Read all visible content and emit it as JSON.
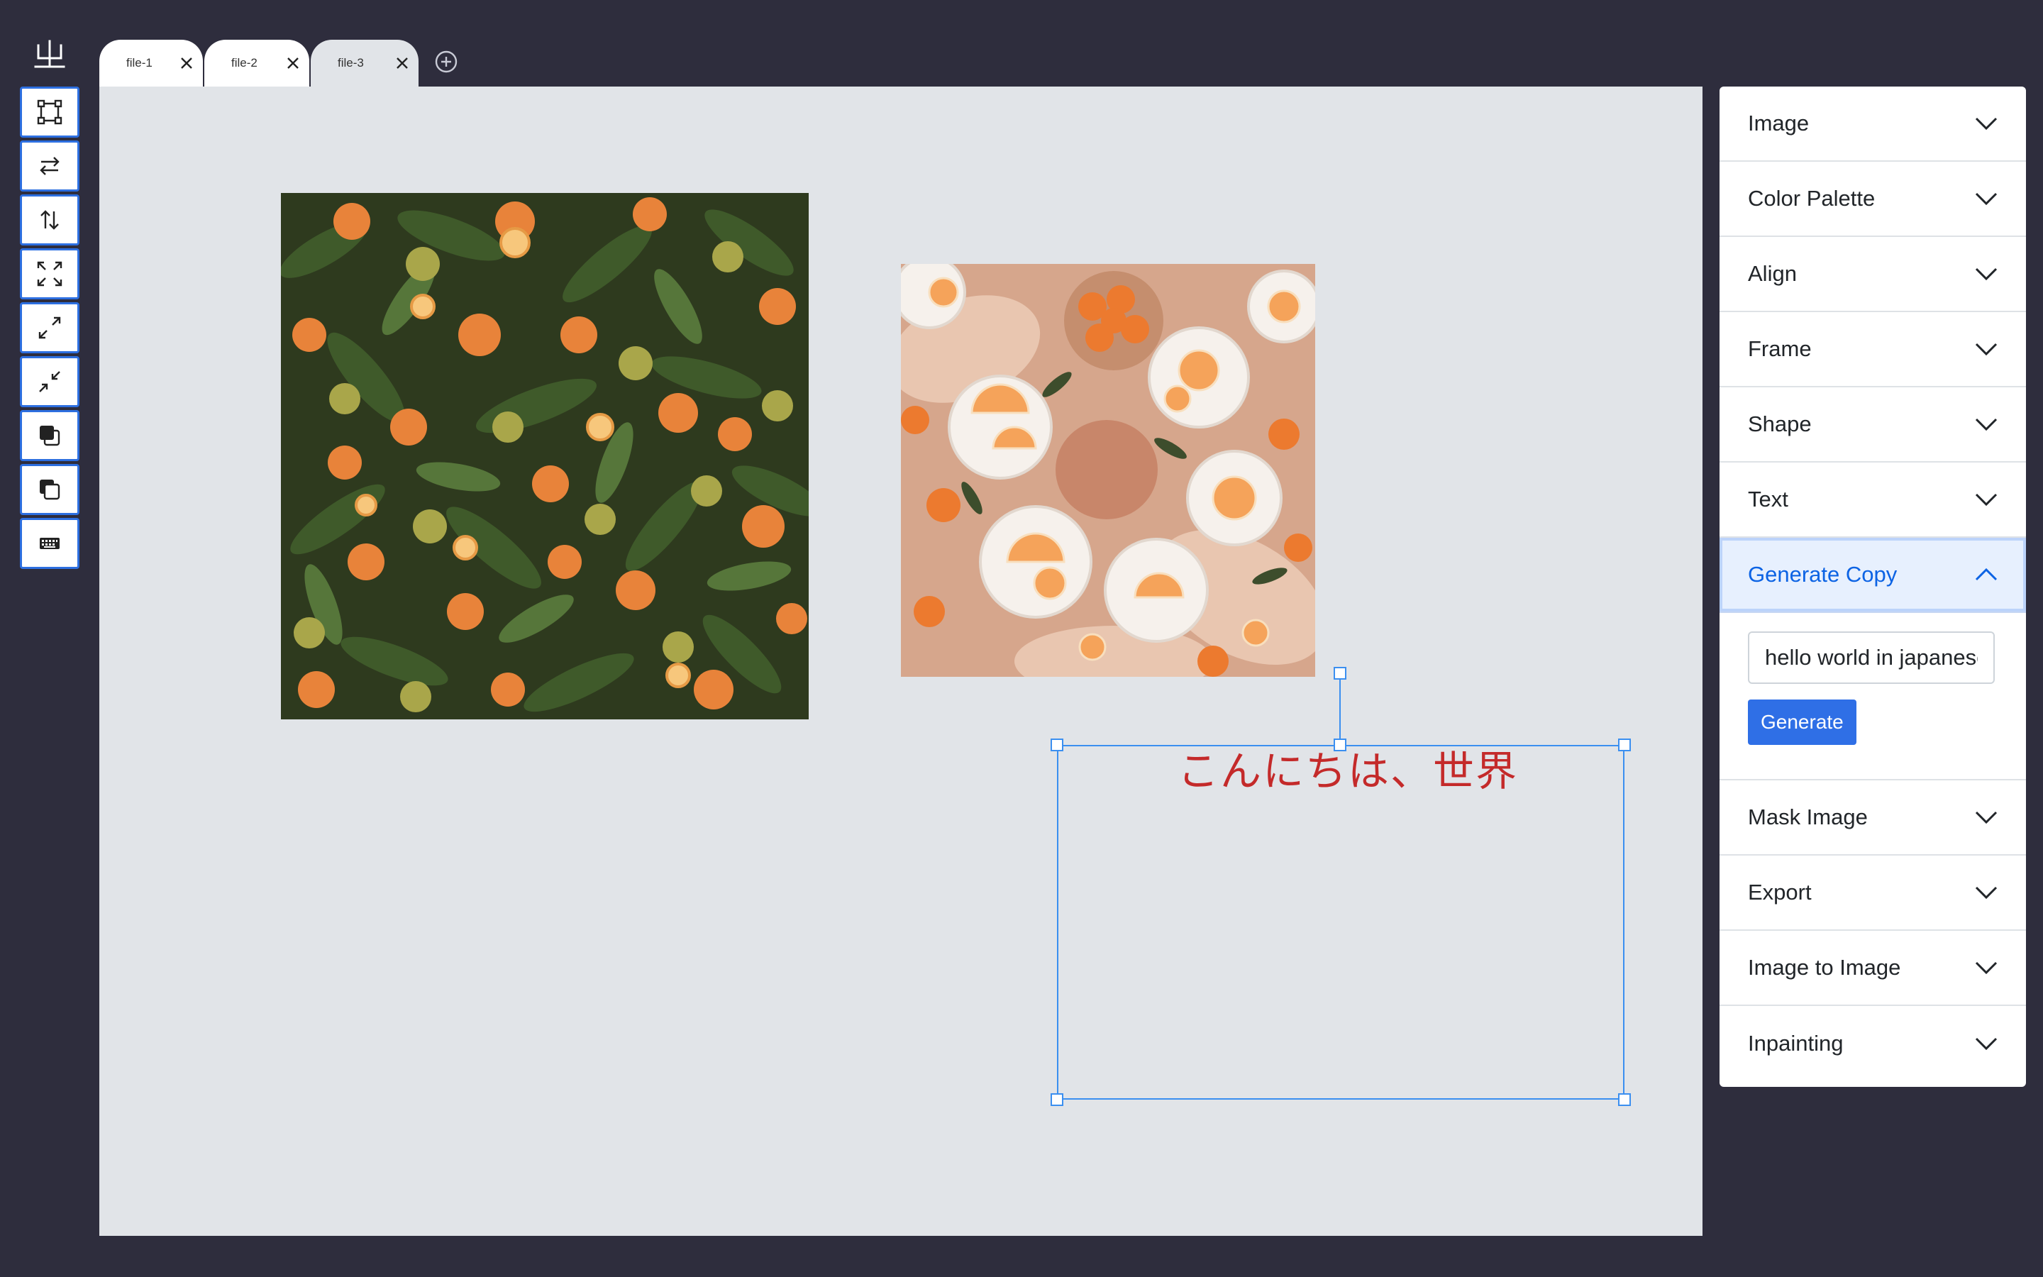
{
  "tabs": [
    {
      "label": "file-1"
    },
    {
      "label": "file-2"
    },
    {
      "label": "file-3"
    }
  ],
  "icons": {
    "logo": "app-logo-icon",
    "add_tab": "plus-circle-icon",
    "tab_close": "close-icon",
    "chevron": "chevron-down-icon",
    "chevron_up": "chevron-up-icon"
  },
  "toolbar": {
    "tools": [
      "transform-icon",
      "flip-horizontal-icon",
      "flip-vertical-icon",
      "fit-canvas-icon",
      "expand-icon",
      "shrink-icon",
      "bring-forward-icon",
      "send-backward-icon",
      "keyboard-icon"
    ]
  },
  "canvas": {
    "text_element": "こんにちは、世界",
    "text_color": "#c42a2a"
  },
  "panel": {
    "sections_top": [
      {
        "label": "Image"
      },
      {
        "label": "Color Palette"
      },
      {
        "label": "Align"
      },
      {
        "label": "Frame"
      },
      {
        "label": "Shape"
      },
      {
        "label": "Text"
      }
    ],
    "active_section": {
      "label": "Generate Copy",
      "input_value": "hello world in japanese",
      "button_label": "Generate"
    },
    "sections_bottom": [
      {
        "label": "Mask Image"
      },
      {
        "label": "Export"
      },
      {
        "label": "Image to Image"
      },
      {
        "label": "Inpainting"
      }
    ]
  },
  "colors": {
    "background": "#2e2d3d",
    "canvas": "#e1e4e8",
    "accent": "#2f6fe6",
    "selection": "#3b8ff0"
  }
}
